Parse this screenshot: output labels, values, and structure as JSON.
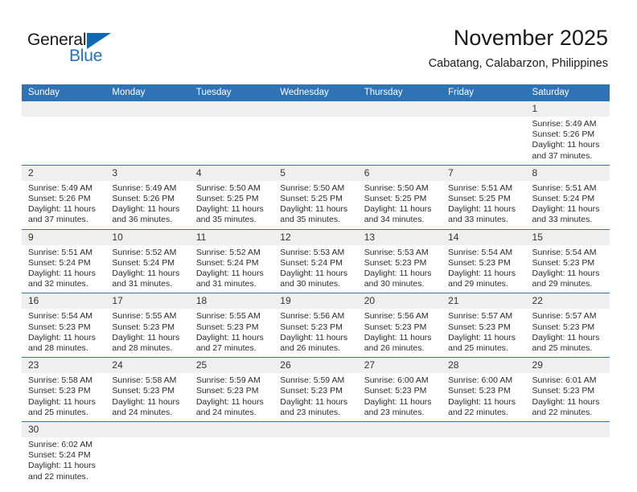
{
  "brand": {
    "name_part1": "General",
    "name_part2": "Blue",
    "accent_color": "#1f74bd",
    "triangle_color": "#1268b3"
  },
  "header": {
    "title": "November 2025",
    "subtitle": "Cabatang, Calabarzon, Philippines",
    "header_bg": "#2d73b5",
    "daynum_bg": "#efefef"
  },
  "weekday_headers": [
    "Sunday",
    "Monday",
    "Tuesday",
    "Wednesday",
    "Thursday",
    "Friday",
    "Saturday"
  ],
  "weeks": [
    [
      {
        "day": "",
        "blank": true
      },
      {
        "day": "",
        "blank": true
      },
      {
        "day": "",
        "blank": true
      },
      {
        "day": "",
        "blank": true
      },
      {
        "day": "",
        "blank": true
      },
      {
        "day": "",
        "blank": true
      },
      {
        "day": "1",
        "sunrise": "Sunrise: 5:49 AM",
        "sunset": "Sunset: 5:26 PM",
        "daylight_line1": "Daylight: 11 hours",
        "daylight_line2": "and 37 minutes."
      }
    ],
    [
      {
        "day": "2",
        "sunrise": "Sunrise: 5:49 AM",
        "sunset": "Sunset: 5:26 PM",
        "daylight_line1": "Daylight: 11 hours",
        "daylight_line2": "and 37 minutes."
      },
      {
        "day": "3",
        "sunrise": "Sunrise: 5:49 AM",
        "sunset": "Sunset: 5:26 PM",
        "daylight_line1": "Daylight: 11 hours",
        "daylight_line2": "and 36 minutes."
      },
      {
        "day": "4",
        "sunrise": "Sunrise: 5:50 AM",
        "sunset": "Sunset: 5:25 PM",
        "daylight_line1": "Daylight: 11 hours",
        "daylight_line2": "and 35 minutes."
      },
      {
        "day": "5",
        "sunrise": "Sunrise: 5:50 AM",
        "sunset": "Sunset: 5:25 PM",
        "daylight_line1": "Daylight: 11 hours",
        "daylight_line2": "and 35 minutes."
      },
      {
        "day": "6",
        "sunrise": "Sunrise: 5:50 AM",
        "sunset": "Sunset: 5:25 PM",
        "daylight_line1": "Daylight: 11 hours",
        "daylight_line2": "and 34 minutes."
      },
      {
        "day": "7",
        "sunrise": "Sunrise: 5:51 AM",
        "sunset": "Sunset: 5:25 PM",
        "daylight_line1": "Daylight: 11 hours",
        "daylight_line2": "and 33 minutes."
      },
      {
        "day": "8",
        "sunrise": "Sunrise: 5:51 AM",
        "sunset": "Sunset: 5:24 PM",
        "daylight_line1": "Daylight: 11 hours",
        "daylight_line2": "and 33 minutes."
      }
    ],
    [
      {
        "day": "9",
        "sunrise": "Sunrise: 5:51 AM",
        "sunset": "Sunset: 5:24 PM",
        "daylight_line1": "Daylight: 11 hours",
        "daylight_line2": "and 32 minutes."
      },
      {
        "day": "10",
        "sunrise": "Sunrise: 5:52 AM",
        "sunset": "Sunset: 5:24 PM",
        "daylight_line1": "Daylight: 11 hours",
        "daylight_line2": "and 31 minutes."
      },
      {
        "day": "11",
        "sunrise": "Sunrise: 5:52 AM",
        "sunset": "Sunset: 5:24 PM",
        "daylight_line1": "Daylight: 11 hours",
        "daylight_line2": "and 31 minutes."
      },
      {
        "day": "12",
        "sunrise": "Sunrise: 5:53 AM",
        "sunset": "Sunset: 5:24 PM",
        "daylight_line1": "Daylight: 11 hours",
        "daylight_line2": "and 30 minutes."
      },
      {
        "day": "13",
        "sunrise": "Sunrise: 5:53 AM",
        "sunset": "Sunset: 5:23 PM",
        "daylight_line1": "Daylight: 11 hours",
        "daylight_line2": "and 30 minutes."
      },
      {
        "day": "14",
        "sunrise": "Sunrise: 5:54 AM",
        "sunset": "Sunset: 5:23 PM",
        "daylight_line1": "Daylight: 11 hours",
        "daylight_line2": "and 29 minutes."
      },
      {
        "day": "15",
        "sunrise": "Sunrise: 5:54 AM",
        "sunset": "Sunset: 5:23 PM",
        "daylight_line1": "Daylight: 11 hours",
        "daylight_line2": "and 29 minutes."
      }
    ],
    [
      {
        "day": "16",
        "sunrise": "Sunrise: 5:54 AM",
        "sunset": "Sunset: 5:23 PM",
        "daylight_line1": "Daylight: 11 hours",
        "daylight_line2": "and 28 minutes."
      },
      {
        "day": "17",
        "sunrise": "Sunrise: 5:55 AM",
        "sunset": "Sunset: 5:23 PM",
        "daylight_line1": "Daylight: 11 hours",
        "daylight_line2": "and 28 minutes."
      },
      {
        "day": "18",
        "sunrise": "Sunrise: 5:55 AM",
        "sunset": "Sunset: 5:23 PM",
        "daylight_line1": "Daylight: 11 hours",
        "daylight_line2": "and 27 minutes."
      },
      {
        "day": "19",
        "sunrise": "Sunrise: 5:56 AM",
        "sunset": "Sunset: 5:23 PM",
        "daylight_line1": "Daylight: 11 hours",
        "daylight_line2": "and 26 minutes."
      },
      {
        "day": "20",
        "sunrise": "Sunrise: 5:56 AM",
        "sunset": "Sunset: 5:23 PM",
        "daylight_line1": "Daylight: 11 hours",
        "daylight_line2": "and 26 minutes."
      },
      {
        "day": "21",
        "sunrise": "Sunrise: 5:57 AM",
        "sunset": "Sunset: 5:23 PM",
        "daylight_line1": "Daylight: 11 hours",
        "daylight_line2": "and 25 minutes."
      },
      {
        "day": "22",
        "sunrise": "Sunrise: 5:57 AM",
        "sunset": "Sunset: 5:23 PM",
        "daylight_line1": "Daylight: 11 hours",
        "daylight_line2": "and 25 minutes."
      }
    ],
    [
      {
        "day": "23",
        "sunrise": "Sunrise: 5:58 AM",
        "sunset": "Sunset: 5:23 PM",
        "daylight_line1": "Daylight: 11 hours",
        "daylight_line2": "and 25 minutes."
      },
      {
        "day": "24",
        "sunrise": "Sunrise: 5:58 AM",
        "sunset": "Sunset: 5:23 PM",
        "daylight_line1": "Daylight: 11 hours",
        "daylight_line2": "and 24 minutes."
      },
      {
        "day": "25",
        "sunrise": "Sunrise: 5:59 AM",
        "sunset": "Sunset: 5:23 PM",
        "daylight_line1": "Daylight: 11 hours",
        "daylight_line2": "and 24 minutes."
      },
      {
        "day": "26",
        "sunrise": "Sunrise: 5:59 AM",
        "sunset": "Sunset: 5:23 PM",
        "daylight_line1": "Daylight: 11 hours",
        "daylight_line2": "and 23 minutes."
      },
      {
        "day": "27",
        "sunrise": "Sunrise: 6:00 AM",
        "sunset": "Sunset: 5:23 PM",
        "daylight_line1": "Daylight: 11 hours",
        "daylight_line2": "and 23 minutes."
      },
      {
        "day": "28",
        "sunrise": "Sunrise: 6:00 AM",
        "sunset": "Sunset: 5:23 PM",
        "daylight_line1": "Daylight: 11 hours",
        "daylight_line2": "and 22 minutes."
      },
      {
        "day": "29",
        "sunrise": "Sunrise: 6:01 AM",
        "sunset": "Sunset: 5:23 PM",
        "daylight_line1": "Daylight: 11 hours",
        "daylight_line2": "and 22 minutes."
      }
    ],
    [
      {
        "day": "30",
        "sunrise": "Sunrise: 6:02 AM",
        "sunset": "Sunset: 5:24 PM",
        "daylight_line1": "Daylight: 11 hours",
        "daylight_line2": "and 22 minutes."
      },
      {
        "day": "",
        "blank": true
      },
      {
        "day": "",
        "blank": true
      },
      {
        "day": "",
        "blank": true
      },
      {
        "day": "",
        "blank": true
      },
      {
        "day": "",
        "blank": true
      },
      {
        "day": "",
        "blank": true
      }
    ]
  ]
}
